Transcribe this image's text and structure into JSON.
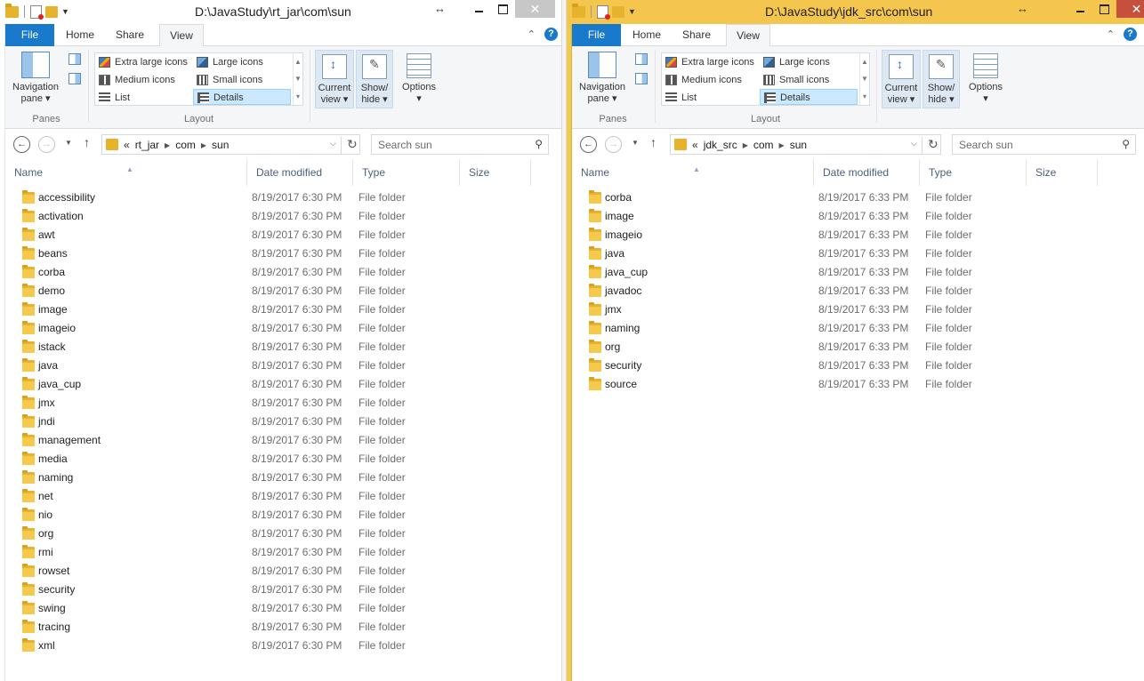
{
  "windows": [
    {
      "id": "left",
      "title": "D:\\JavaStudy\\rt_jar\\com\\sun",
      "tabs": {
        "file": "File",
        "home": "Home",
        "share": "Share",
        "view": "View"
      },
      "ribbon": {
        "navigation_pane": "Navigation pane",
        "panes_group": "Panes",
        "layout_group": "Layout",
        "layout_options": {
          "extra_large": "Extra large icons",
          "large": "Large icons",
          "medium": "Medium icons",
          "small": "Small icons",
          "list": "List",
          "details": "Details"
        },
        "selected_layout": "Details",
        "current_view": "Current view",
        "show_hide": "Show/ hide",
        "options": "Options"
      },
      "address": {
        "crumbs": [
          "rt_jar",
          "com",
          "sun"
        ],
        "overflow": "«"
      },
      "search_placeholder": "Search sun",
      "columns": {
        "name": "Name",
        "date": "Date modified",
        "type": "Type",
        "size": "Size"
      },
      "items": [
        {
          "name": "accessibility",
          "date": "8/19/2017 6:30 PM",
          "type": "File folder"
        },
        {
          "name": "activation",
          "date": "8/19/2017 6:30 PM",
          "type": "File folder"
        },
        {
          "name": "awt",
          "date": "8/19/2017 6:30 PM",
          "type": "File folder"
        },
        {
          "name": "beans",
          "date": "8/19/2017 6:30 PM",
          "type": "File folder"
        },
        {
          "name": "corba",
          "date": "8/19/2017 6:30 PM",
          "type": "File folder"
        },
        {
          "name": "demo",
          "date": "8/19/2017 6:30 PM",
          "type": "File folder"
        },
        {
          "name": "image",
          "date": "8/19/2017 6:30 PM",
          "type": "File folder"
        },
        {
          "name": "imageio",
          "date": "8/19/2017 6:30 PM",
          "type": "File folder"
        },
        {
          "name": "istack",
          "date": "8/19/2017 6:30 PM",
          "type": "File folder"
        },
        {
          "name": "java",
          "date": "8/19/2017 6:30 PM",
          "type": "File folder"
        },
        {
          "name": "java_cup",
          "date": "8/19/2017 6:30 PM",
          "type": "File folder"
        },
        {
          "name": "jmx",
          "date": "8/19/2017 6:30 PM",
          "type": "File folder"
        },
        {
          "name": "jndi",
          "date": "8/19/2017 6:30 PM",
          "type": "File folder"
        },
        {
          "name": "management",
          "date": "8/19/2017 6:30 PM",
          "type": "File folder"
        },
        {
          "name": "media",
          "date": "8/19/2017 6:30 PM",
          "type": "File folder"
        },
        {
          "name": "naming",
          "date": "8/19/2017 6:30 PM",
          "type": "File folder"
        },
        {
          "name": "net",
          "date": "8/19/2017 6:30 PM",
          "type": "File folder"
        },
        {
          "name": "nio",
          "date": "8/19/2017 6:30 PM",
          "type": "File folder"
        },
        {
          "name": "org",
          "date": "8/19/2017 6:30 PM",
          "type": "File folder"
        },
        {
          "name": "rmi",
          "date": "8/19/2017 6:30 PM",
          "type": "File folder"
        },
        {
          "name": "rowset",
          "date": "8/19/2017 6:30 PM",
          "type": "File folder"
        },
        {
          "name": "security",
          "date": "8/19/2017 6:30 PM",
          "type": "File folder"
        },
        {
          "name": "swing",
          "date": "8/19/2017 6:30 PM",
          "type": "File folder"
        },
        {
          "name": "tracing",
          "date": "8/19/2017 6:30 PM",
          "type": "File folder"
        },
        {
          "name": "xml",
          "date": "8/19/2017 6:30 PM",
          "type": "File folder"
        }
      ]
    },
    {
      "id": "right",
      "title": "D:\\JavaStudy\\jdk_src\\com\\sun",
      "tabs": {
        "file": "File",
        "home": "Home",
        "share": "Share",
        "view": "View"
      },
      "ribbon": {
        "navigation_pane": "Navigation pane",
        "panes_group": "Panes",
        "layout_group": "Layout",
        "layout_options": {
          "extra_large": "Extra large icons",
          "large": "Large icons",
          "medium": "Medium icons",
          "small": "Small icons",
          "list": "List",
          "details": "Details"
        },
        "selected_layout": "Details",
        "current_view": "Current view",
        "show_hide": "Show/ hide",
        "options": "Options"
      },
      "address": {
        "crumbs": [
          "jdk_src",
          "com",
          "sun"
        ],
        "overflow": "«"
      },
      "search_placeholder": "Search sun",
      "columns": {
        "name": "Name",
        "date": "Date modified",
        "type": "Type",
        "size": "Size"
      },
      "items": [
        {
          "name": "corba",
          "date": "8/19/2017 6:33 PM",
          "type": "File folder"
        },
        {
          "name": "image",
          "date": "8/19/2017 6:33 PM",
          "type": "File folder"
        },
        {
          "name": "imageio",
          "date": "8/19/2017 6:33 PM",
          "type": "File folder"
        },
        {
          "name": "java",
          "date": "8/19/2017 6:33 PM",
          "type": "File folder"
        },
        {
          "name": "java_cup",
          "date": "8/19/2017 6:33 PM",
          "type": "File folder"
        },
        {
          "name": "javadoc",
          "date": "8/19/2017 6:33 PM",
          "type": "File folder"
        },
        {
          "name": "jmx",
          "date": "8/19/2017 6:33 PM",
          "type": "File folder"
        },
        {
          "name": "naming",
          "date": "8/19/2017 6:33 PM",
          "type": "File folder"
        },
        {
          "name": "org",
          "date": "8/19/2017 6:33 PM",
          "type": "File folder"
        },
        {
          "name": "security",
          "date": "8/19/2017 6:33 PM",
          "type": "File folder"
        },
        {
          "name": "source",
          "date": "8/19/2017 6:33 PM",
          "type": "File folder"
        }
      ]
    }
  ],
  "colors": {
    "file_tab": "#1979ca",
    "active_title_bar": "#f4c64e",
    "folder": "#e8b32c",
    "selection": "#cce8ff",
    "column_header_text": "#4c607a",
    "secondary_text": "#6d6d6d"
  },
  "icons": {
    "quick_access": [
      "folder-icon",
      "properties-icon",
      "new-folder-icon"
    ],
    "navigation": [
      "back-icon",
      "forward-icon",
      "recent-locations-icon",
      "up-icon",
      "refresh-icon",
      "search-icon"
    ]
  }
}
